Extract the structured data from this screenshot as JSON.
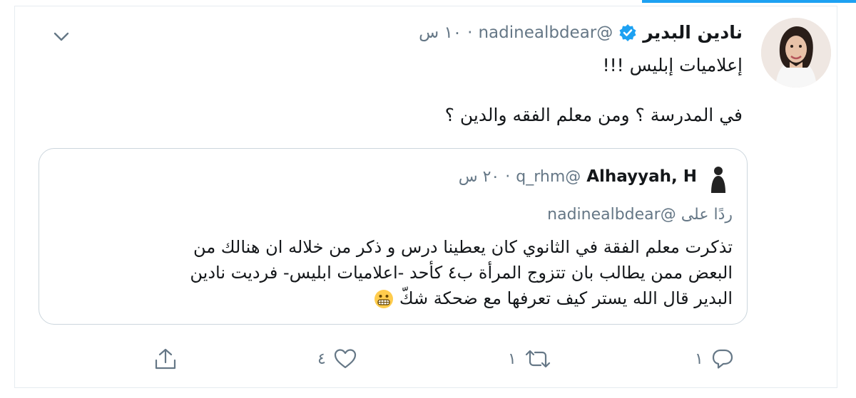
{
  "tweet": {
    "author": {
      "name": "نادين البدير",
      "handle": "@nadinealbdear",
      "time": "١٠ س",
      "separator": "·"
    },
    "text_lines": [
      "إعلاميات إبليس !!!",
      "في المدرسة ؟ ومن معلم الفقه والدين ؟"
    ],
    "quoted": {
      "name": "Alhayyah, H",
      "handle": "@q_rhm",
      "time": "٢٠ س",
      "separator": "·",
      "reply_prefix": "ردًا على",
      "reply_to": "@nadinealbdear",
      "body_lines": [
        "تذكرت معلم الفقة في الثانوي كان يعطينا درس و ذكر من خلاله ان هنالك من",
        "البعض ممن يطالب بان تتزوج المرأة ب٤ كأحد -اعلاميات ابليس- فرديت نادين",
        "البدير قال الله يستر كيف تعرفها مع ضحكة شكّ"
      ]
    },
    "actions": {
      "replies": "١",
      "retweets": "١",
      "likes": "٤"
    }
  },
  "colors": {
    "accent": "#1da1f2",
    "secondary_text": "#657786",
    "border": "#ccd6dd"
  },
  "icons": {
    "verified": "verified-badge-icon",
    "chevron": "chevron-down-icon",
    "reply": "reply-icon",
    "retweet": "retweet-icon",
    "like": "heart-icon",
    "share": "share-icon",
    "emoji": "grimacing-face-emoji"
  }
}
